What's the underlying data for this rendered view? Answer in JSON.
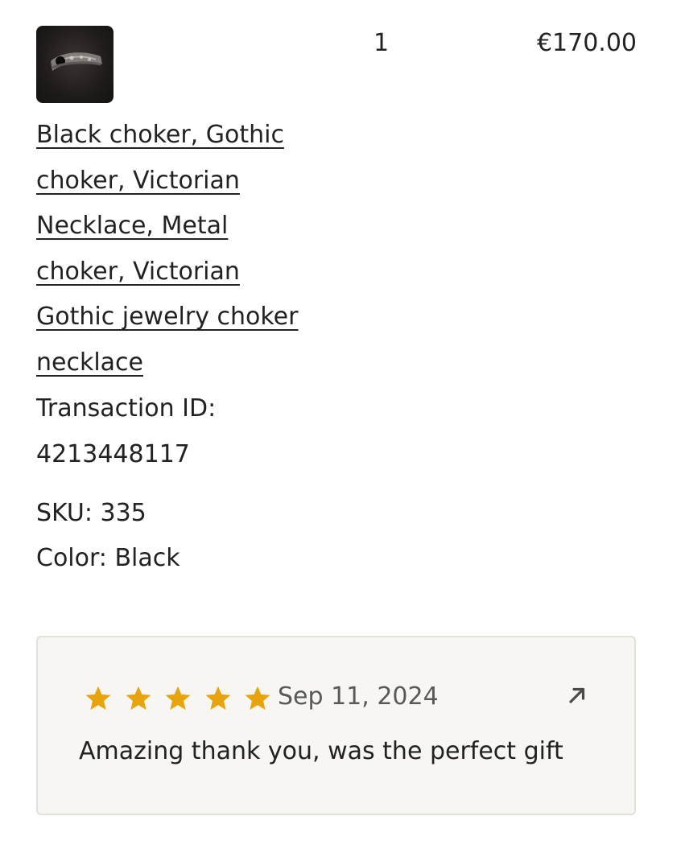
{
  "order_item": {
    "image_alt": "Black choker necklace thumbnail",
    "quantity": "1",
    "price": "€170.00",
    "title_lines": [
      "Black choker, Gothic",
      "choker, Victorian",
      "Necklace, Metal",
      "choker, Victorian",
      "Gothic jewelry choker",
      "necklace"
    ],
    "transaction_label": "Transaction ID:",
    "transaction_id": "4213448117",
    "sku": "SKU: 335",
    "color": "Color: Black"
  },
  "review": {
    "rating": 5,
    "max_rating": 5,
    "star_color": "#e8a40c",
    "date": "Sep 11, 2024",
    "text": "Amazing thank you, was the perfect gift",
    "open_icon": "arrow-up-right-icon"
  }
}
